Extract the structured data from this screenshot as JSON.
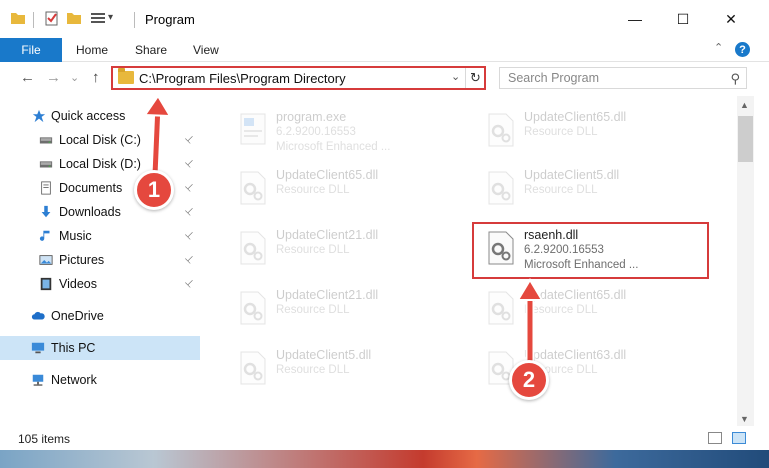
{
  "window": {
    "title": "Program",
    "minimize": "—",
    "maximize": "☐",
    "close": "✕"
  },
  "ribbon": {
    "file": "File",
    "home": "Home",
    "share": "Share",
    "view": "View",
    "help": "?",
    "collapse": "⌃"
  },
  "nav": {
    "back": "←",
    "forward": "→",
    "recent": "⌄",
    "up": "↑",
    "address": "C:\\Program Files\\Program Directory",
    "address_dropdown": "⌄",
    "refresh": "↻",
    "search_placeholder": "Search Program",
    "search_icon": "⚲"
  },
  "sidebar": {
    "quick_access": "Quick access",
    "items": [
      {
        "label": "Local Disk (C:)",
        "icon": "drive-icon",
        "pinned": true
      },
      {
        "label": "Local Disk (D:)",
        "icon": "drive-icon",
        "pinned": true
      },
      {
        "label": "Documents",
        "icon": "documents-icon",
        "pinned": true
      },
      {
        "label": "Downloads",
        "icon": "downloads-icon",
        "pinned": true
      },
      {
        "label": "Music",
        "icon": "music-icon",
        "pinned": true
      },
      {
        "label": "Pictures",
        "icon": "pictures-icon",
        "pinned": true
      },
      {
        "label": "Videos",
        "icon": "videos-icon",
        "pinned": true
      }
    ],
    "onedrive": "OneDrive",
    "this_pc": "This PC",
    "network": "Network",
    "pin_glyph": "📌"
  },
  "files": [
    {
      "name": "program.exe",
      "line2": "6.2.9200.16553",
      "line3": "Microsoft Enhanced ...",
      "faded": true
    },
    {
      "name": "UpdateClient65.dll",
      "line2": "Resource DLL",
      "line3": "",
      "faded": true
    },
    {
      "name": "UpdateClient65.dll",
      "line2": "Resource DLL",
      "line3": "",
      "faded": true
    },
    {
      "name": "UpdateClient5.dll",
      "line2": "Resource DLL",
      "line3": "",
      "faded": true
    },
    {
      "name": "UpdateClient21.dll",
      "line2": "Resource DLL",
      "line3": "",
      "faded": true
    },
    {
      "name": "rsaenh.dll",
      "line2": "6.2.9200.16553",
      "line3": "Microsoft Enhanced ...",
      "faded": false
    },
    {
      "name": "UpdateClient21.dll",
      "line2": "Resource DLL",
      "line3": "",
      "faded": true
    },
    {
      "name": "UpdateClient65.dll",
      "line2": "Resource DLL",
      "line3": "",
      "faded": true
    },
    {
      "name": "UpdateClient5.dll",
      "line2": "Resource DLL",
      "line3": "",
      "faded": true
    },
    {
      "name": "UpdateClient63.dll",
      "line2": "Resource DLL",
      "line3": "",
      "faded": true
    }
  ],
  "status": {
    "items_count": "105 items"
  },
  "callouts": {
    "one": "1",
    "two": "2"
  },
  "colors": {
    "accent": "#1979ca",
    "highlight": "#d63b3b",
    "callout": "#e5483e",
    "selected": "#cce4f7"
  }
}
